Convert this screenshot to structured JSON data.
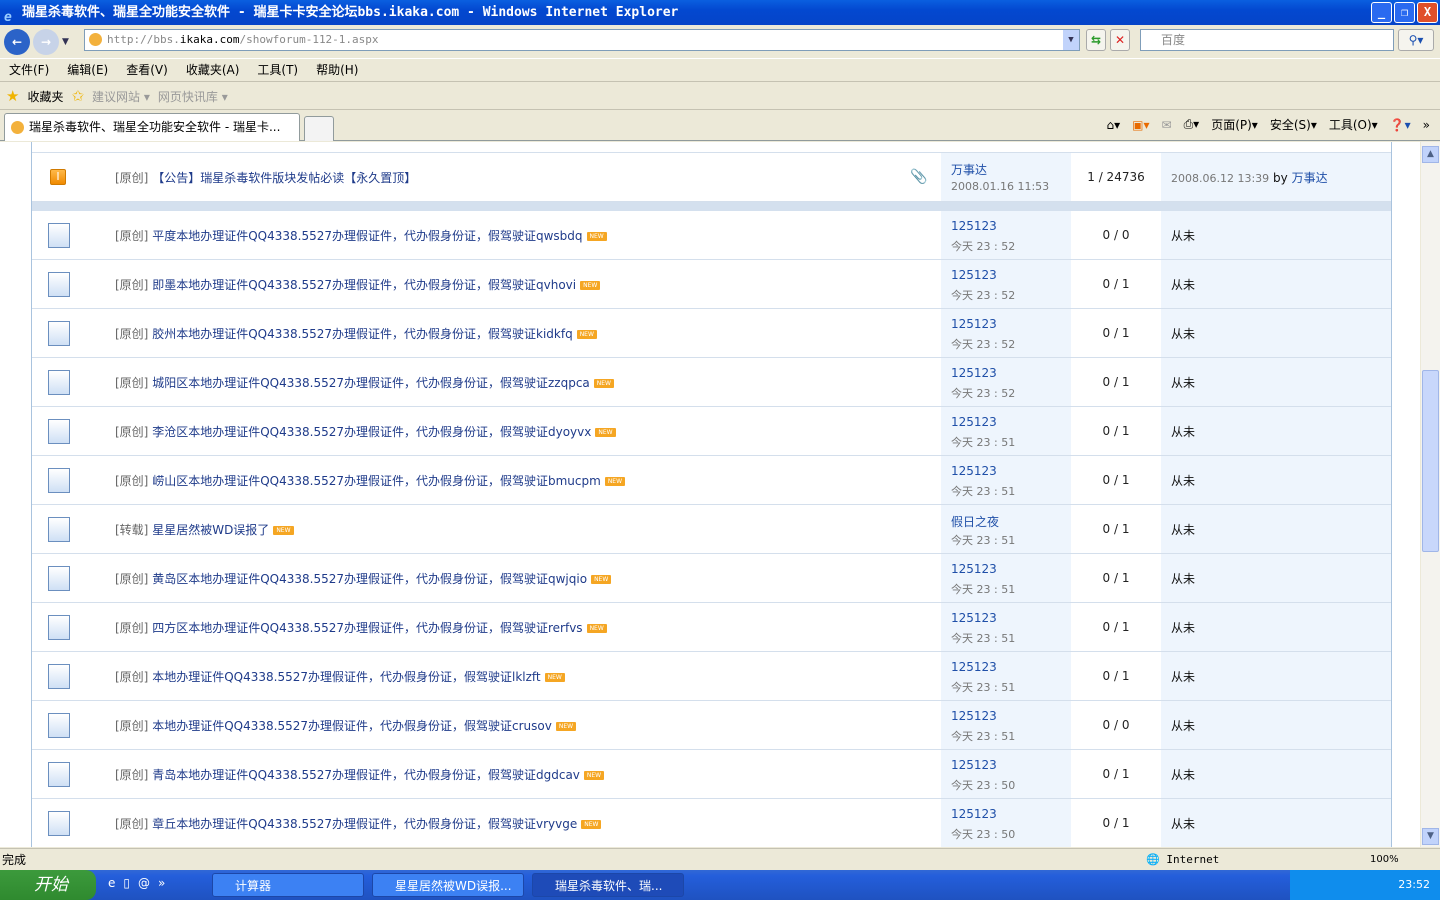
{
  "window": {
    "title": "瑞星杀毒软件、瑞星全功能安全软件 - 瑞星卡卡安全论坛bbs.ikaka.com - Windows Internet Explorer",
    "min": "_",
    "restore": "❐",
    "close": "X"
  },
  "address": {
    "prefix": "http://bbs.",
    "host": "ikaka.com",
    "path": "/showforum-112-1.aspx",
    "search_placeholder": "百度"
  },
  "menu": [
    "文件(F)",
    "编辑(E)",
    "查看(V)",
    "收藏夹(A)",
    "工具(T)",
    "帮助(H)"
  ],
  "favbar": {
    "favorites": "收藏夹",
    "suggested": "建议网站",
    "webslice": "网页快讯库"
  },
  "tab": {
    "title": "瑞星杀毒软件、瑞星全功能安全软件 - 瑞星卡..."
  },
  "commandbar": {
    "page": "页面(P)",
    "safety": "安全(S)",
    "tools": "工具(O)",
    "more": "»"
  },
  "pinned": {
    "prefix": "[原创]",
    "title": "【公告】瑞星杀毒软件版块发帖必读【永久置顶】",
    "author": "万事达",
    "time": "2008.01.16 11:53",
    "counts": "1 / 24736",
    "last_date": "2008.06.12 13:39",
    "by": "by",
    "last_author": "万事达"
  },
  "new_badge": "NEW",
  "threads": [
    {
      "prefix": "[原创]",
      "title": "平度本地办理证件QQ4338.5527办理假证件，代办假身份证，假驾驶证qwsbdq",
      "author": "125123",
      "time": "今天 23 : 52",
      "counts": "0 / 0",
      "last": "从未"
    },
    {
      "prefix": "[原创]",
      "title": "即墨本地办理证件QQ4338.5527办理假证件，代办假身份证，假驾驶证qvhovi",
      "author": "125123",
      "time": "今天 23 : 52",
      "counts": "0 / 1",
      "last": "从未"
    },
    {
      "prefix": "[原创]",
      "title": "胶州本地办理证件QQ4338.5527办理假证件，代办假身份证，假驾驶证kidkfq",
      "author": "125123",
      "time": "今天 23 : 52",
      "counts": "0 / 1",
      "last": "从未"
    },
    {
      "prefix": "[原创]",
      "title": "城阳区本地办理证件QQ4338.5527办理假证件，代办假身份证，假驾驶证zzqpca",
      "author": "125123",
      "time": "今天 23 : 52",
      "counts": "0 / 1",
      "last": "从未"
    },
    {
      "prefix": "[原创]",
      "title": "李沧区本地办理证件QQ4338.5527办理假证件，代办假身份证，假驾驶证dyoyvx",
      "author": "125123",
      "time": "今天 23 : 51",
      "counts": "0 / 1",
      "last": "从未"
    },
    {
      "prefix": "[原创]",
      "title": "崂山区本地办理证件QQ4338.5527办理假证件，代办假身份证，假驾驶证bmucpm",
      "author": "125123",
      "time": "今天 23 : 51",
      "counts": "0 / 1",
      "last": "从未"
    },
    {
      "prefix": "[转载]",
      "title": "星星居然被WD误报了",
      "author": "假日之夜",
      "time": "今天 23 : 51",
      "counts": "0 / 1",
      "last": "从未"
    },
    {
      "prefix": "[原创]",
      "title": "黄岛区本地办理证件QQ4338.5527办理假证件，代办假身份证，假驾驶证qwjqio",
      "author": "125123",
      "time": "今天 23 : 51",
      "counts": "0 / 1",
      "last": "从未"
    },
    {
      "prefix": "[原创]",
      "title": "四方区本地办理证件QQ4338.5527办理假证件，代办假身份证，假驾驶证rerfvs",
      "author": "125123",
      "time": "今天 23 : 51",
      "counts": "0 / 1",
      "last": "从未"
    },
    {
      "prefix": "[原创]",
      "title": "本地办理证件QQ4338.5527办理假证件，代办假身份证，假驾驶证lklzft",
      "author": "125123",
      "time": "今天 23 : 51",
      "counts": "0 / 1",
      "last": "从未"
    },
    {
      "prefix": "[原创]",
      "title": "本地办理证件QQ4338.5527办理假证件，代办假身份证，假驾驶证crusov",
      "author": "125123",
      "time": "今天 23 : 51",
      "counts": "0 / 0",
      "last": "从未"
    },
    {
      "prefix": "[原创]",
      "title": "青岛本地办理证件QQ4338.5527办理假证件，代办假身份证，假驾驶证dgdcav",
      "author": "125123",
      "time": "今天 23 : 50",
      "counts": "0 / 1",
      "last": "从未"
    },
    {
      "prefix": "[原创]",
      "title": "章丘本地办理证件QQ4338.5527办理假证件，代办假身份证，假驾驶证vryvge",
      "author": "125123",
      "time": "今天 23 : 50",
      "counts": "0 / 1",
      "last": "从未"
    }
  ],
  "status": {
    "text": "完成",
    "zone": "Internet",
    "zoom": "100%"
  },
  "taskbar": {
    "start": "开始",
    "tasks": [
      "计算器",
      "星星居然被WD误报...",
      "瑞星杀毒软件、瑞..."
    ],
    "clock": "23:52"
  }
}
